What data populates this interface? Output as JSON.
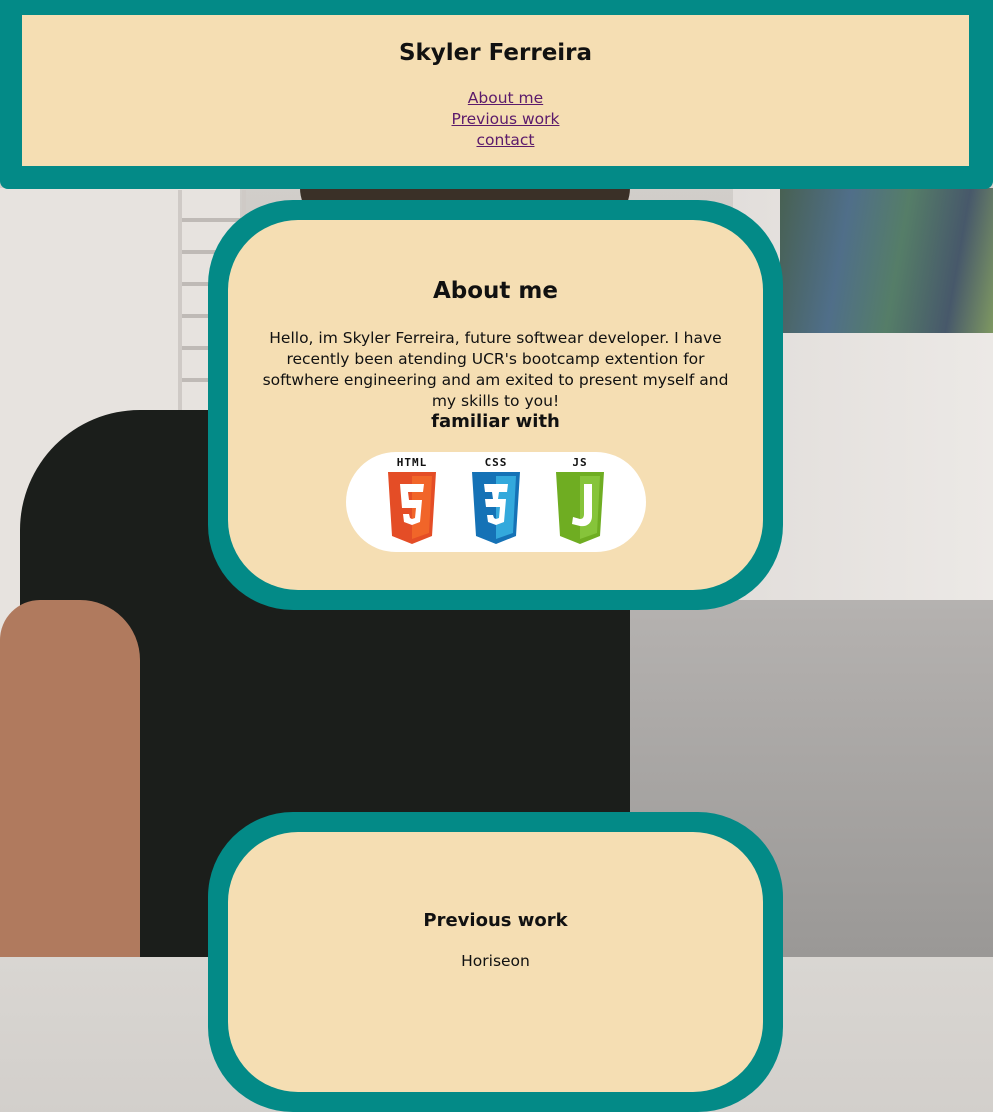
{
  "header": {
    "title": "Skyler Ferreira",
    "nav": [
      "About me",
      "Previous work",
      "contact"
    ]
  },
  "about": {
    "title": "About me",
    "text": "Hello, im Skyler Ferreira, future softwear developer. I have recently been atending UCR's bootcamp extention for softwhere engineering and am exited to present myself and my skills to you!",
    "familiar_title": "familiar with",
    "logos": [
      {
        "label": "HTML",
        "icon": "html5-icon",
        "color": "#e44d26"
      },
      {
        "label": "CSS",
        "icon": "css3-icon",
        "color": "#1572b6"
      },
      {
        "label": "JS",
        "icon": "js-icon",
        "color": "#6fad22"
      }
    ]
  },
  "previous_work": {
    "title": "Previous work",
    "items": [
      "Horiseon"
    ]
  },
  "colors": {
    "accent": "#038a87",
    "panel": "#f5deb3",
    "link": "#5b1a6b"
  }
}
